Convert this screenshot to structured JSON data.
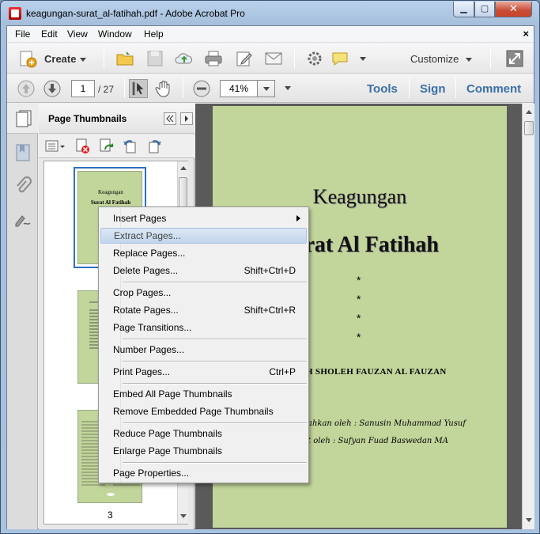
{
  "window": {
    "title": "keagungan-surat_al-fatihah.pdf - Adobe Acrobat Pro"
  },
  "menubar": {
    "items": [
      "File",
      "Edit",
      "View",
      "Window",
      "Help"
    ],
    "close": "×"
  },
  "toolbar": {
    "create": "Create",
    "customize": "Customize"
  },
  "nav": {
    "page": "1",
    "total": "/ 27",
    "zoom": "41%"
  },
  "links": {
    "tools": "Tools",
    "sign": "Sign",
    "comment": "Comment"
  },
  "panel": {
    "title": "Page Thumbnails",
    "page_label": "3"
  },
  "thumb1": {
    "line1": "Keagungan",
    "line2": "Surat Al Fatihah"
  },
  "document": {
    "title1": "Keagungan",
    "title2": "rat Al Fatihah",
    "stars": [
      "*",
      "*",
      "*",
      "*"
    ],
    "author": "H SHOLEH FAUZAN AL FAUZAN",
    "line1": "ahkan oleh : Sanusin Muhammad Yusuf",
    "line2": "t oleh : Sufyan Fuad Baswedan MA"
  },
  "context_menu": {
    "items": [
      {
        "label": "Insert Pages",
        "shortcut": "",
        "submenu": true
      },
      {
        "label": "Extract Pages...",
        "shortcut": "",
        "highlighted": true
      },
      {
        "label": "Replace Pages...",
        "shortcut": ""
      },
      {
        "label": "Delete Pages...",
        "shortcut": "Shift+Ctrl+D"
      },
      {
        "label": "Crop Pages...",
        "shortcut": ""
      },
      {
        "label": "Rotate Pages...",
        "shortcut": "Shift+Ctrl+R"
      },
      {
        "label": "Page Transitions...",
        "shortcut": ""
      },
      {
        "label": "Number Pages...",
        "shortcut": ""
      },
      {
        "label": "Print Pages...",
        "shortcut": "Ctrl+P"
      },
      {
        "label": "Embed All Page Thumbnails",
        "shortcut": ""
      },
      {
        "label": "Remove Embedded Page Thumbnails",
        "shortcut": ""
      },
      {
        "label": "Reduce Page Thumbnails",
        "shortcut": ""
      },
      {
        "label": "Enlarge Page Thumbnails",
        "shortcut": ""
      },
      {
        "label": "Page Properties...",
        "shortcut": ""
      }
    ]
  },
  "colors": {
    "page_bg": "#c2d59b",
    "link": "#3a6fa8",
    "highlight": "#c2d5ec"
  }
}
